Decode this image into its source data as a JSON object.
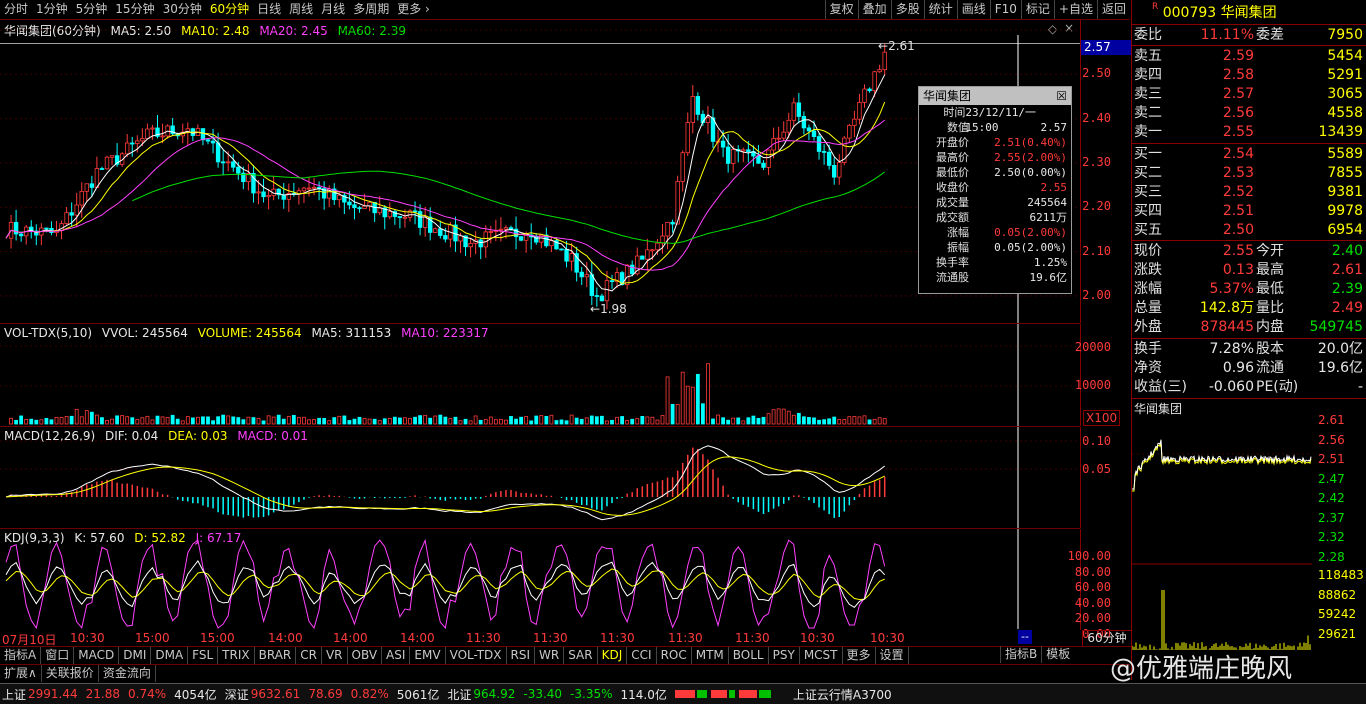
{
  "topbar": {
    "timeframes": [
      "分时",
      "1分钟",
      "5分钟",
      "15分钟",
      "30分钟",
      "60分钟",
      "日线",
      "周线",
      "月线",
      "多周期",
      "更多 ›"
    ],
    "active_timeframe": "60分钟",
    "tools": [
      "复权",
      "叠加",
      "多股",
      "统计",
      "画线",
      "F10",
      "标记",
      "+自选",
      "返回"
    ]
  },
  "main_title": {
    "name": "华闻集团(60分钟)",
    "ma5": "MA5: 2.50",
    "ma10": "MA10: 2.48",
    "ma20": "MA20: 2.45",
    "ma60": "MA60: 2.39"
  },
  "price_axis": [
    "2.50",
    "2.40",
    "2.30",
    "2.20",
    "2.10",
    "2.00"
  ],
  "price_marker": "2.57",
  "high_label": "2.61",
  "low_label": "1.98",
  "tooltip": {
    "title": "华闻集团",
    "rows": [
      {
        "k": "时间",
        "v": "23/12/11/一 15:00",
        "c": "wht"
      },
      {
        "k": "数值",
        "v": "2.57",
        "c": "wht"
      },
      {
        "k": "开盘价",
        "v": "2.51(0.40%)",
        "c": "red"
      },
      {
        "k": "最高价",
        "v": "2.55(2.00%)",
        "c": "red"
      },
      {
        "k": "最低价",
        "v": "2.50(0.00%)",
        "c": "wht"
      },
      {
        "k": "收盘价",
        "v": "2.55",
        "c": "red"
      },
      {
        "k": "成交量",
        "v": "245564",
        "c": "wht"
      },
      {
        "k": "成交额",
        "v": "6211万",
        "c": "wht"
      },
      {
        "k": "涨幅",
        "v": "0.05(2.00%)",
        "c": "red"
      },
      {
        "k": "振幅",
        "v": "0.05(2.00%)",
        "c": "wht"
      },
      {
        "k": "换手率",
        "v": "1.25%",
        "c": "wht"
      },
      {
        "k": "流通股",
        "v": "19.6亿",
        "c": "wht"
      }
    ]
  },
  "vol_title": {
    "name": "VOL-TDX(5,10)",
    "vvol": "VVOL: 245564",
    "volume": "VOLUME: 245564",
    "ma5": "MA5: 311153",
    "ma10": "MA10: 223317"
  },
  "vol_axis": [
    "20000",
    "10000"
  ],
  "vol_unit": "X100",
  "macd_title": {
    "name": "MACD(12,26,9)",
    "dif": "DIF: 0.04",
    "dea": "DEA: 0.03",
    "macd": "MACD: 0.01"
  },
  "macd_axis": [
    "0.10",
    "0.05"
  ],
  "kdj_title": {
    "name": "KDJ(9,3,3)",
    "k": "K: 57.60",
    "d": "D: 52.82",
    "j": "J: 67.17"
  },
  "kdj_axis": [
    "100.00",
    "80.00",
    "60.00",
    "40.00",
    "20.00",
    "0.00"
  ],
  "time_axis": [
    "07月10日",
    "10:30",
    "15:00",
    "15:00",
    "14:00",
    "14:00",
    "14:00",
    "11:30",
    "11:30",
    "11:30",
    "11:30",
    "11:30",
    "10:30",
    "10:30"
  ],
  "time_axis_right": "--",
  "indicator_tabs": [
    "指标A",
    "窗口",
    "MACD",
    "DMI",
    "DMA",
    "FSL",
    "TRIX",
    "BRAR",
    "CR",
    "VR",
    "OBV",
    "ASI",
    "EMV",
    "VOL-TDX",
    "RSI",
    "WR",
    "SAR",
    "KDJ",
    "CCI",
    "ROC",
    "MTM",
    "BOLL",
    "PSY",
    "MCST",
    "更多",
    "设置"
  ],
  "active_indicator": "KDJ",
  "right_bottom_tabs": [
    "指标B",
    "模板"
  ],
  "period_label": "60分钟",
  "bottom_tabs": [
    "扩展∧",
    "关联报价",
    "资金流向"
  ],
  "stock": {
    "code": "000793",
    "name": "华闻集团",
    "weibi_label": "委比",
    "weibi": "11.11%",
    "weicha_label": "委差",
    "weicha": "7950",
    "asks": [
      {
        "label": "卖五",
        "price": "2.59",
        "vol": "5454"
      },
      {
        "label": "卖四",
        "price": "2.58",
        "vol": "5291"
      },
      {
        "label": "卖三",
        "price": "2.57",
        "vol": "3065"
      },
      {
        "label": "卖二",
        "price": "2.56",
        "vol": "4558"
      },
      {
        "label": "卖一",
        "price": "2.55",
        "vol": "13439"
      }
    ],
    "bids": [
      {
        "label": "买一",
        "price": "2.54",
        "vol": "5589"
      },
      {
        "label": "买二",
        "price": "2.53",
        "vol": "7855"
      },
      {
        "label": "买三",
        "price": "2.52",
        "vol": "9381"
      },
      {
        "label": "买四",
        "price": "2.51",
        "vol": "9978"
      },
      {
        "label": "买五",
        "price": "2.50",
        "vol": "6954"
      }
    ],
    "quote": [
      {
        "l": "现价",
        "m": "2.55",
        "mc": "red",
        "l2": "今开",
        "r": "2.40",
        "rc": "grn"
      },
      {
        "l": "涨跌",
        "m": "0.13",
        "mc": "red",
        "l2": "最高",
        "r": "2.61",
        "rc": "red"
      },
      {
        "l": "涨幅",
        "m": "5.37%",
        "mc": "red",
        "l2": "最低",
        "r": "2.39",
        "rc": "grn"
      },
      {
        "l": "总量",
        "m": "142.8万",
        "mc": "yel",
        "l2": "量比",
        "r": "2.49",
        "rc": "red"
      },
      {
        "l": "外盘",
        "m": "878445",
        "mc": "red",
        "l2": "内盘",
        "r": "549745",
        "rc": "grn"
      }
    ],
    "fund": [
      {
        "l": "换手",
        "m": "7.28%",
        "l2": "股本",
        "r": "20.0亿"
      },
      {
        "l": "净资",
        "m": "0.96",
        "l2": "流通",
        "r": "19.6亿"
      },
      {
        "l": "收益(三)",
        "m": "-0.060",
        "l2": "PE(动)",
        "r": "-"
      }
    ],
    "mini_title": "华闻集团",
    "mini_price_axis": [
      "2.61",
      "2.56",
      "2.51",
      "2.47",
      "2.42",
      "2.37",
      "2.32",
      "2.28"
    ],
    "mini_vol_axis": [
      "118483",
      "88862",
      "59242",
      "29621"
    ]
  },
  "status": {
    "sh_label": "上证",
    "sh_val": "2991.44",
    "sh_chg": "21.88",
    "sh_pct": "0.74%",
    "sh_amt": "4054亿",
    "sz_label": "深证",
    "sz_val": "9632.61",
    "sz_chg": "78.69",
    "sz_pct": "0.82%",
    "sz_amt": "5061亿",
    "bz_label": "北证",
    "bz_val": "964.92",
    "bz_chg": "-33.40",
    "bz_pct": "-3.35%",
    "bz_amt": "114.0亿",
    "cloud": "上证云行情A3700"
  },
  "watermark": "@优雅端庄晚风",
  "colors": {
    "up": "#ff3a3a",
    "down": "#00ffff",
    "ma5": "#ffffff",
    "ma10": "#ffff00",
    "ma20": "#ff40ff",
    "ma60": "#00e000",
    "border": "#8a0000"
  }
}
